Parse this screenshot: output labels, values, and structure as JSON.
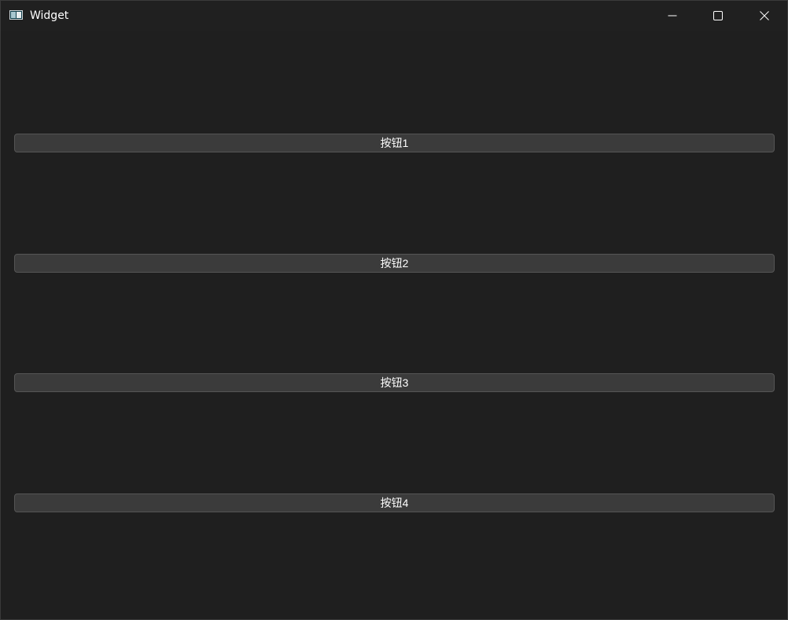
{
  "window": {
    "title": "Widget",
    "app_icon": "window-app-icon",
    "controls": {
      "minimize": "minimize-icon",
      "maximize": "maximize-icon",
      "close": "close-icon"
    }
  },
  "buttons": [
    {
      "label": "按钮1"
    },
    {
      "label": "按钮2"
    },
    {
      "label": "按钮3"
    },
    {
      "label": "按钮4"
    }
  ],
  "colors": {
    "background": "#1f1f1f",
    "button_bg": "#3b3b3b",
    "button_border": "#555555",
    "text": "#ffffff"
  }
}
